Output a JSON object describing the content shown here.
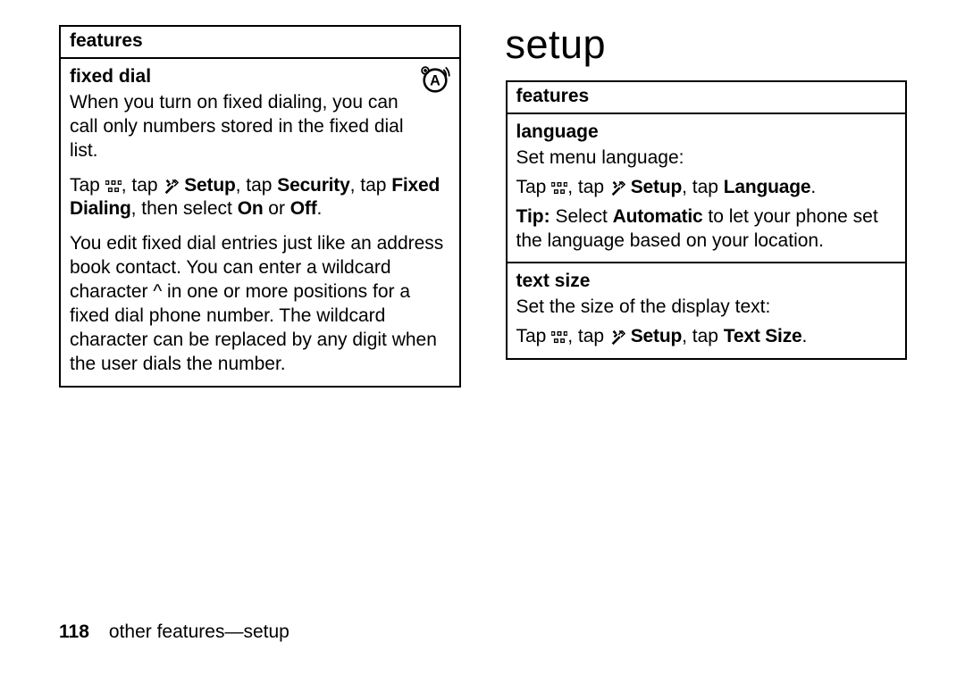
{
  "left": {
    "header": "features",
    "section": {
      "title": "fixed dial",
      "p1": "When you turn on fixed dialing, you can call only numbers stored in the fixed dial list.",
      "nav_pre": "Tap ",
      "nav_mid1": ", tap ",
      "nav_setup": "Setup",
      "nav_mid2": ", tap ",
      "nav_security": "Security",
      "nav_mid3": ", tap ",
      "nav_fixed": "Fixed Dialing",
      "nav_mid4": ", then select ",
      "nav_on": "On",
      "nav_mid5": " or ",
      "nav_off": "Off",
      "nav_end": ".",
      "p3": "You edit fixed dial entries just like an address book contact. You can enter a wildcard character ^ in one or more positions for a fixed dial phone number. The wildcard character can be replaced by any digit when the user dials the number."
    }
  },
  "right": {
    "heading": "setup",
    "header": "features",
    "lang": {
      "title": "language",
      "p1": "Set menu language:",
      "nav_pre": "Tap ",
      "nav_mid1": ", tap ",
      "nav_setup": "Setup",
      "nav_mid2": ", tap ",
      "nav_language": "Language",
      "nav_end": ".",
      "tip_pre": "Tip:",
      "tip_mid1": " Select ",
      "tip_auto": "Automatic",
      "tip_mid2": " to let your phone set the language based on your location."
    },
    "text": {
      "title": "text size",
      "p1": "Set the size of the display text:",
      "nav_pre": "Tap ",
      "nav_mid1": ", tap ",
      "nav_setup": "Setup",
      "nav_mid2": ", tap ",
      "nav_textsize": "Text Size",
      "nav_end": "."
    }
  },
  "footer": {
    "page": "118",
    "label": "other features—setup"
  }
}
